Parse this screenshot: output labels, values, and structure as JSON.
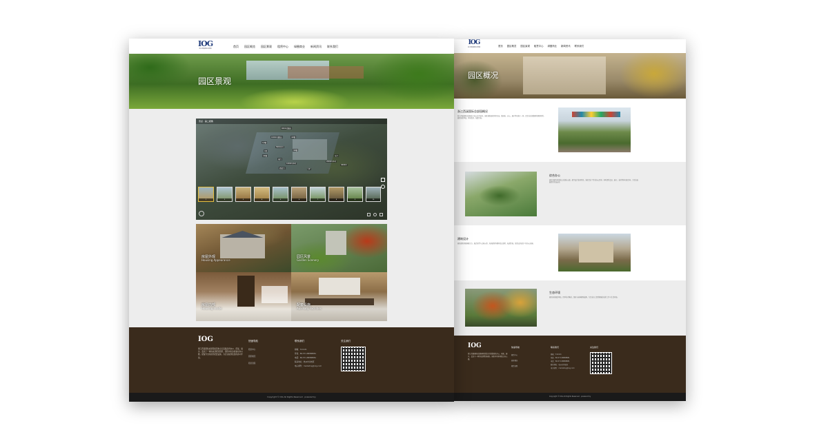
{
  "left_page": {
    "logo": {
      "mark": "IOG",
      "sub": "浙江西溪国际总部园"
    },
    "nav": [
      "首页",
      "园区概览",
      "园区景观",
      "租赁中心",
      "绿圈商业",
      "新闻资讯",
      "联系我们"
    ],
    "banner_title": "园区景观",
    "tour_header": "景点 · 第二视角",
    "tour_pins": [
      "600m(酒店)",
      "1000m(酒店)",
      "4#楼",
      "1#楼",
      "500m(C)",
      "C区",
      "3#楼",
      "2#楼",
      "南门",
      "东门",
      "1000m(A2)",
      "2000m(A1)",
      "西北门",
      "4000m",
      "1#"
    ],
    "tour_thumbs": [
      "1",
      "2",
      "3",
      "4",
      "5",
      "6",
      "7",
      "8",
      "9",
      "10"
    ],
    "tiles": [
      {
        "zh": "房屋外观",
        "en": "Housing Appearance"
      },
      {
        "zh": "园区风景",
        "en": "Garden Scenery"
      },
      {
        "zh": "房屋内部",
        "en": "Housing Inside"
      },
      {
        "zh": "配套设施",
        "en": "Auxiliary Facilities"
      }
    ],
    "footer": {
      "logo": "IOG",
      "about": "浙江西溪国际总部园项目重点打造集商务办公、研发、展示、会议于一体的总部经济园区，园区内有多栋独立办公楼，配备齐全的商务配套设施，为企业提供优质的办公环境。",
      "col1_title": "快速导航",
      "col1_lines": [
        "租赁中心",
        "园区概况",
        "租赁流程"
      ],
      "col2_title": "联系我们",
      "col2_lines": [
        "邮编：311121",
        "传真：86-571-88888881",
        "电话：86-571-88888881",
        "联系地址：杭州市余杭区",
        "电子邮件：marketing@iog.com"
      ],
      "col3_title": "关注我们",
      "copyright": "Copyright © IOG All Rights Reserved · powered by"
    }
  },
  "right_page": {
    "logo": {
      "mark": "IOG",
      "sub": "浙江西溪国际总部园"
    },
    "nav": [
      "首页",
      "园区概览",
      "园区景观",
      "租赁中心",
      "绿圈商业",
      "新闻资讯",
      "联系我们"
    ],
    "banner_title": "园区概况",
    "sections": [
      {
        "title": "浙江西溪国际总部园概况",
        "text": "浙江西溪国际总部园位于杭州市余杭区，园区规划面积约四百亩，集研发、办公、展示等功能于一体，是企业总部集聚的理想场所。园区绿化率高，环境优美，配套完善。"
      },
      {
        "title": "综合办公",
        "text": "园区内建有多栋独立总部办公楼，楼宇设计独具特色，满足企业个性化办公需求。同时提供会议、展示、接待等多功能空间，为企业发展提供全面支持。"
      },
      {
        "title": "建筑设计",
        "text": "园区建筑风格典雅大方，融合现代与古典元素，每栋建筑均拥有独立庭院，私密性强，营造出舒适宜人的办公氛围。"
      },
      {
        "title": "生态环境",
        "text": "园区绿化覆盖率高，四季花木繁茂，湖景与园林相映成趣，为企业员工提供健康舒适的工作与生活环境。"
      }
    ],
    "footer": {
      "logo": "IOG",
      "about": "浙江西溪国际总部园项目重点打造集商务办公、研发、展示、会议于一体的总部经济园区，园区内有多栋独立办公楼。",
      "col1_title": "快速导航",
      "col1_lines": [
        "租赁中心",
        "园区概况",
        "租赁流程"
      ],
      "col2_title": "联系我们",
      "col2_lines": [
        "邮编：311121",
        "传真：86-571-88888881",
        "电话：86-571-88888881",
        "联系地址：杭州市余杭区",
        "电子邮件：marketing@iog.com"
      ],
      "col3_title": "关注我们",
      "copyright": "Copyright © IOG All Rights Reserved · powered by"
    }
  },
  "colors": {
    "footer_bg": "#3a2b1c",
    "copy_bg": "#1a1a1a",
    "logo_blue": "#1f3a7a",
    "section_gray": "#ededed"
  }
}
